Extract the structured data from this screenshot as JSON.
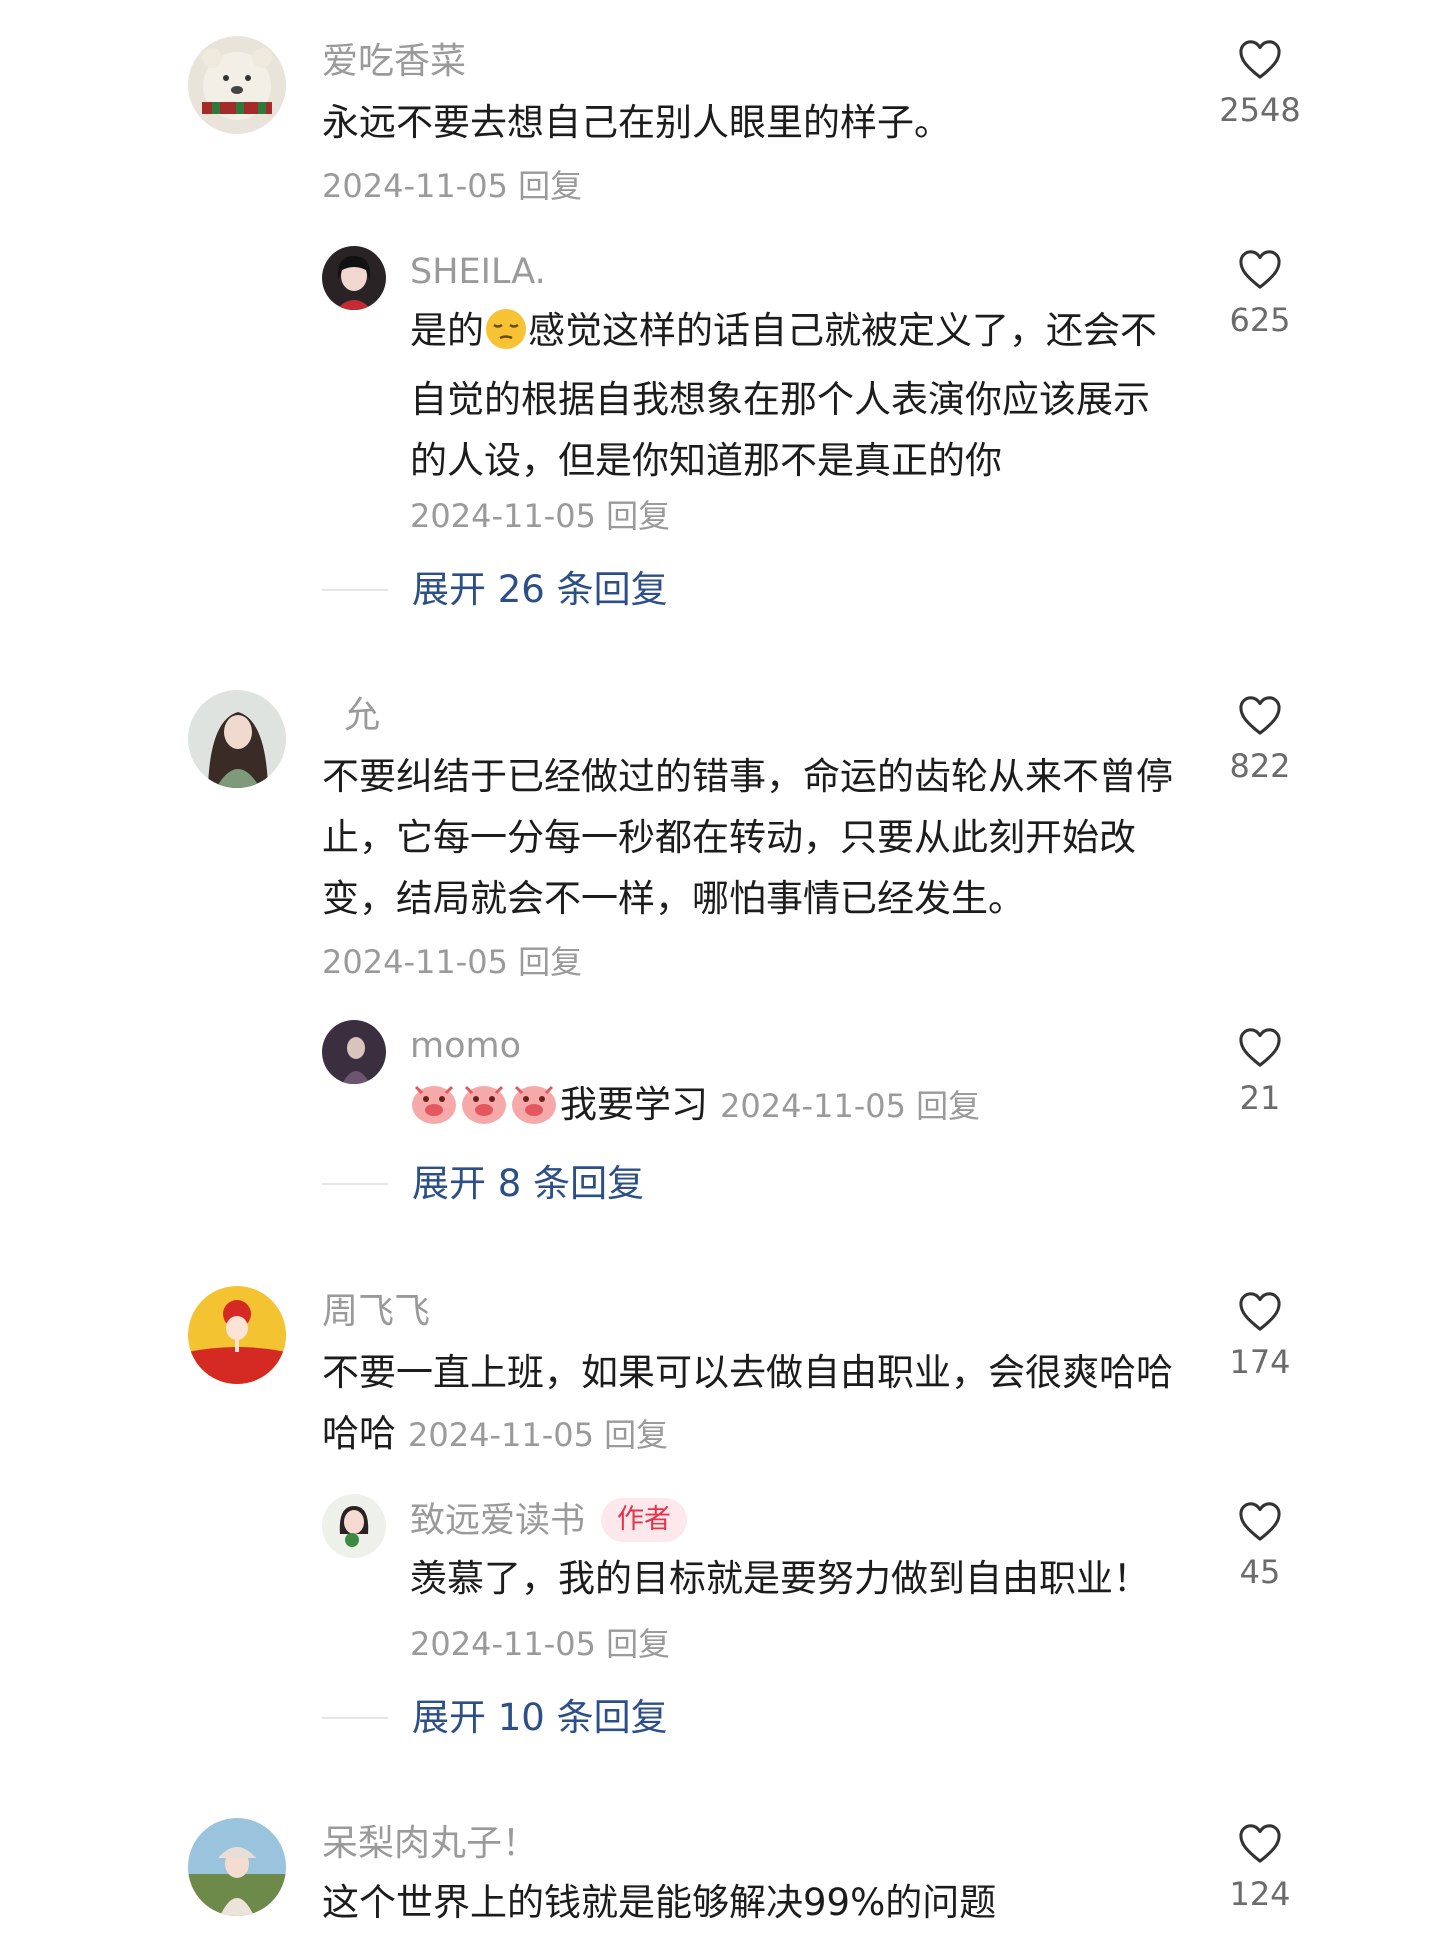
{
  "threads": [
    {
      "comment": {
        "user": "爱吃香菜",
        "text": "永远不要去想自己在别人眼里的样子。",
        "date": "2024-11-05",
        "reply": "回复",
        "likes": "2548",
        "avatar": "polar-bear-avatar"
      },
      "replies": [
        {
          "user": "SHEILA.",
          "text_before_emoji": "是的",
          "emoji": "pensive-face-emoji",
          "text_after_emoji": "感觉这样的话自己就被定义了，还会不自觉的根据自我想象在那个人表演你应该展示的人设，但是你知道那不是真正的你",
          "date": "2024-11-05",
          "reply": "回复",
          "likes": "625"
        }
      ],
      "expand": "展开 26 条回复"
    },
    {
      "comment": {
        "user": "允",
        "text": "不要纠结于已经做过的错事，命运的齿轮从来不曾停止，它每一分每一秒都在转动，只要从此刻开始改变，结局就会不一样，哪怕事情已经发生。",
        "date": "2024-11-05",
        "reply": "回复",
        "likes": "822"
      },
      "replies": [
        {
          "user": "momo",
          "emoji": "crying-pig-emoji",
          "text": "我要学习",
          "date": "2024-11-05",
          "reply": "回复",
          "likes": "21"
        }
      ],
      "expand": "展开 8 条回复"
    },
    {
      "comment": {
        "user": "周飞飞",
        "text": "不要一直上班，如果可以去做自由职业，会很爽哈哈哈哈",
        "date": "2024-11-05",
        "reply": "回复",
        "likes": "174"
      },
      "replies": [
        {
          "user": "致远爱读书",
          "badge": "作者",
          "text": "羡慕了，我的目标就是要努力做到自由职业！",
          "date": "2024-11-05",
          "reply": "回复",
          "likes": "45"
        }
      ],
      "expand": "展开 10 条回复"
    },
    {
      "comment": {
        "user": "呆梨肉丸子！",
        "text": "这个世界上的钱就是能够解决99%的问题",
        "likes": "124"
      }
    }
  ],
  "colors": {
    "expand_link": "#2c4f87",
    "author_badge_text": "#e8314a",
    "author_badge_bg": "#fde9ec",
    "secondary_text": "#9a9a9a"
  }
}
